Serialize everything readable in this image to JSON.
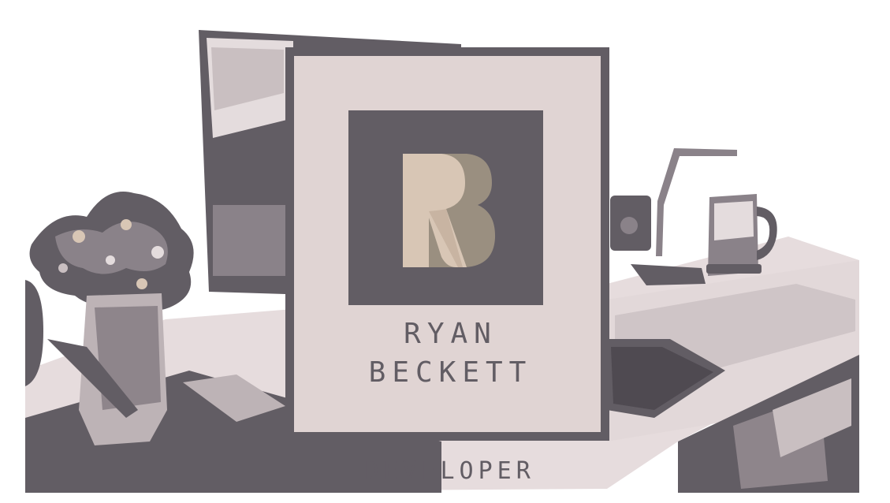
{
  "profile": {
    "first_name": "RYAN",
    "last_name": "BECKETT",
    "role": "DEVELOPER",
    "logo_letters": "RB"
  },
  "background": {
    "scene": "desk-workspace-illustration"
  },
  "colors": {
    "primary": "#625d64",
    "card": "#e0d4d3",
    "logo_r": "#d8c6b5",
    "logo_b": "#9a8f80",
    "desk_light": "#e9e2e3",
    "desk_mid": "#a69c9f"
  }
}
